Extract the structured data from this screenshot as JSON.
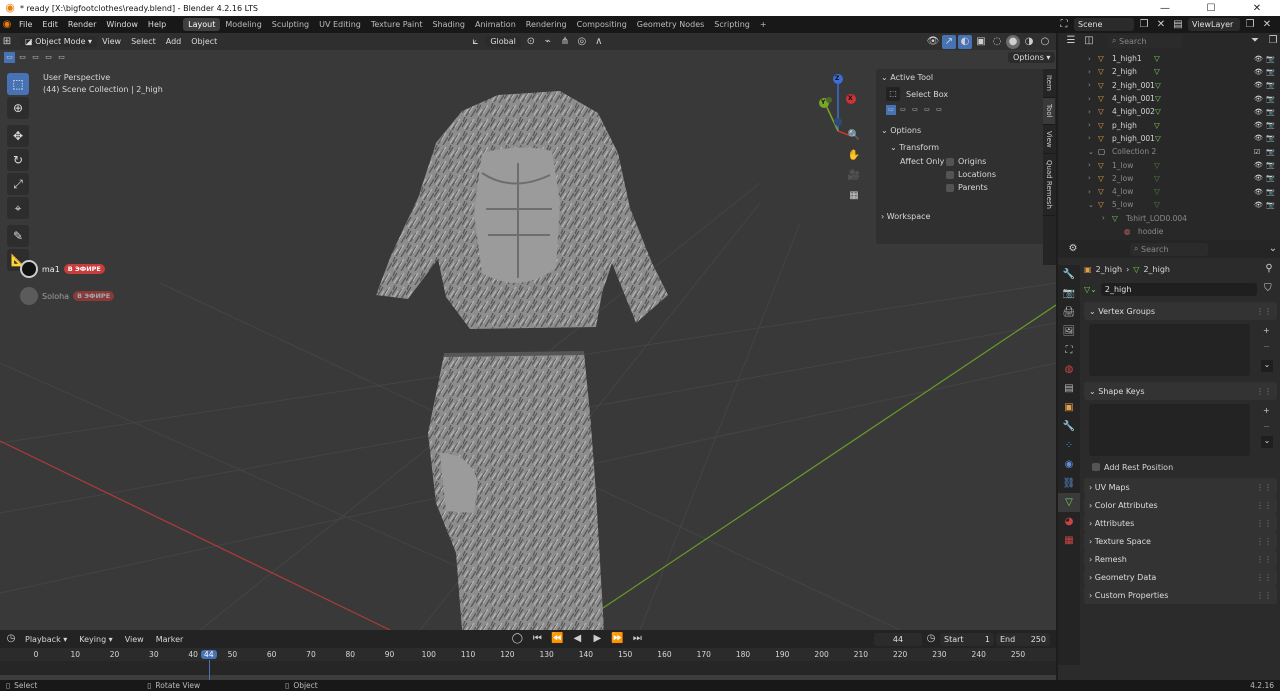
{
  "window": {
    "title": "* ready [X:\\bigfootclothes\\ready.blend] - Blender 4.2.16 LTS"
  },
  "menu": [
    "File",
    "Edit",
    "Render",
    "Window",
    "Help"
  ],
  "workspaces": [
    "Layout",
    "Modeling",
    "Sculpting",
    "UV Editing",
    "Texture Paint",
    "Shading",
    "Animation",
    "Rendering",
    "Compositing",
    "Geometry Nodes",
    "Scripting"
  ],
  "active_workspace": "Layout",
  "scene": "Scene",
  "view_layer": "ViewLayer",
  "viewport": {
    "mode": "Object Mode",
    "menus": [
      "View",
      "Select",
      "Add",
      "Object"
    ],
    "orientation": "Global",
    "options_label": "Options",
    "info_line1": "User Perspective",
    "info_line2": "(44) Scene Collection | 2_high",
    "gizmo": {
      "x": "X",
      "y": "Y",
      "z": "Z"
    },
    "overlay_users": [
      {
        "name": "ma1",
        "badge": "В ЭФИРЕ"
      },
      {
        "name": "Soloha",
        "badge": "В ЭФИРЕ"
      }
    ]
  },
  "npanel": {
    "active_tool_header": "Active Tool",
    "tool_name": "Select Box",
    "options_header": "Options",
    "transform_header": "Transform",
    "affect_only_label": "Affect Only",
    "affect_only": [
      "Origins",
      "Locations",
      "Parents"
    ],
    "workspace_header": "Workspace",
    "tabs": [
      "Item",
      "Tool",
      "View",
      "Quad Remesh"
    ]
  },
  "outliner": {
    "search_placeholder": "Search",
    "items": [
      {
        "name": "1_high1"
      },
      {
        "name": "2_high"
      },
      {
        "name": "2_high_001"
      },
      {
        "name": "4_high_001"
      },
      {
        "name": "4_high_002"
      },
      {
        "name": "p_high"
      },
      {
        "name": "p_high_001"
      },
      {
        "name": "Collection 2"
      },
      {
        "name": "1_low"
      },
      {
        "name": "2_low"
      },
      {
        "name": "4_low"
      },
      {
        "name": "5_low"
      },
      {
        "name": "Tshirt_LOD0.004"
      },
      {
        "name": "hoodie"
      }
    ]
  },
  "properties": {
    "search_placeholder": "Search",
    "breadcrumb_object": "2_high",
    "breadcrumb_data": "2_high",
    "mesh_name": "2_high",
    "vertex_groups": "Vertex Groups",
    "shape_keys": "Shape Keys",
    "add_rest_position": "Add Rest Position",
    "collapsed_sections": [
      "UV Maps",
      "Color Attributes",
      "Attributes",
      "Texture Space",
      "Remesh",
      "Geometry Data",
      "Custom Properties"
    ]
  },
  "timeline": {
    "menus": [
      "Playback",
      "Keying",
      "View",
      "Marker"
    ],
    "current_frame": "44",
    "start_label": "Start",
    "start_value": "1",
    "end_label": "End",
    "end_value": "250",
    "ticks": [
      "0",
      "10",
      "20",
      "30",
      "40",
      "44",
      "50",
      "60",
      "70",
      "80",
      "90",
      "100",
      "110",
      "120",
      "130",
      "140",
      "150",
      "160",
      "170",
      "180",
      "190",
      "200",
      "210",
      "220",
      "230",
      "240",
      "250"
    ]
  },
  "statusbar": {
    "select": "Select",
    "rotate_view": "Rotate View",
    "object": "Object",
    "version": "4.2.16"
  },
  "colors": {
    "accent": "#4772b3",
    "grid_x": "#b03a3a",
    "grid_y": "#6a9a2a",
    "badge": "#c83c3c"
  }
}
